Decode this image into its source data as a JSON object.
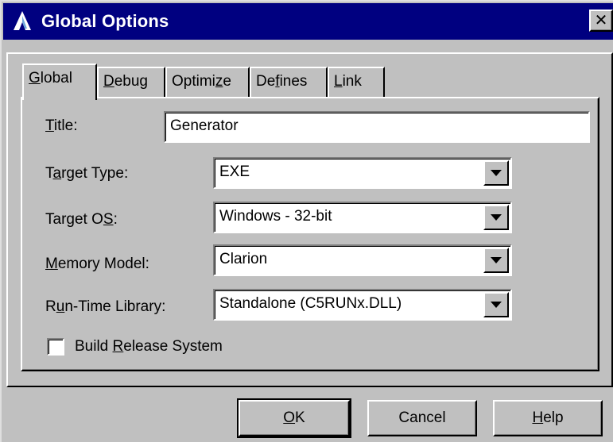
{
  "window": {
    "title": "Global Options",
    "close_glyph": "✕"
  },
  "tabs": [
    {
      "pre": "",
      "key": "G",
      "post": "lobal",
      "active": true
    },
    {
      "pre": "",
      "key": "D",
      "post": "ebug"
    },
    {
      "pre": "Optimi",
      "key": "z",
      "post": "e"
    },
    {
      "pre": "De",
      "key": "f",
      "post": "ines"
    },
    {
      "pre": "",
      "key": "L",
      "post": "ink"
    }
  ],
  "form": {
    "title_label": {
      "pre": "",
      "key": "T",
      "post": "itle:"
    },
    "title_value": "Generator",
    "target_type": {
      "label_pre": "T",
      "label_key": "a",
      "label_post": "rget Type:",
      "value": "EXE"
    },
    "target_os": {
      "label_pre": "Target O",
      "label_key": "S",
      "label_post": ":",
      "value": "Windows - 32-bit"
    },
    "memory_model": {
      "label_pre": "",
      "label_key": "M",
      "label_post": "emory Model:",
      "value": "Clarion"
    },
    "runtime_library": {
      "label_pre": "R",
      "label_key": "u",
      "label_post": "n-Time Library:",
      "value": "Standalone (C5RUNx.DLL)"
    },
    "build_release": {
      "pre": "Build ",
      "key": "R",
      "post": "elease System",
      "checked": false
    }
  },
  "buttons": {
    "ok": {
      "pre": "",
      "key": "O",
      "post": "K"
    },
    "cancel": "Cancel",
    "help": {
      "pre": "",
      "key": "H",
      "post": "elp"
    }
  },
  "icons": {
    "app": "clarion-app-icon",
    "dropdown": "dropdown-arrow-icon",
    "close": "close-icon"
  },
  "colors": {
    "titlebar": "#000080",
    "face": "#c0c0c0",
    "field": "#ffffff"
  }
}
